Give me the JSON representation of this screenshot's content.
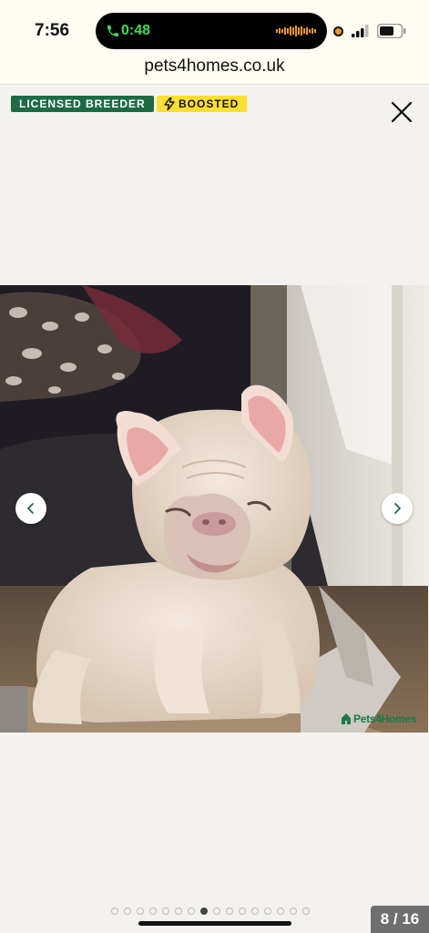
{
  "status_bar": {
    "time": "7:56",
    "call_timer": "0:48"
  },
  "browser": {
    "url": "pets4homes.co.uk"
  },
  "badges": {
    "licensed": "LICENSED BREEDER",
    "boosted": "BOOSTED"
  },
  "gallery": {
    "watermark": "Pets4Homes",
    "counter": "8 / 16",
    "total_dots": 16,
    "active_dot": 8
  },
  "colors": {
    "licensed_badge": "#1c6b43",
    "boosted_badge": "#fde02f",
    "call_green": "#3ddc5c",
    "background": "#f4f2ee"
  }
}
